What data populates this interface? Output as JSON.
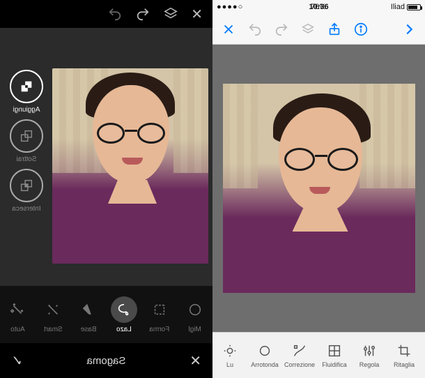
{
  "left": {
    "selection_modes": [
      {
        "label": "Aggiungi",
        "active": true
      },
      {
        "label": "Sottrai",
        "active": false
      },
      {
        "label": "Interseca",
        "active": false
      }
    ],
    "tools": [
      {
        "label": "Migl"
      },
      {
        "label": "Forma"
      },
      {
        "label": "Lazo",
        "active": true
      },
      {
        "label": "Base"
      },
      {
        "label": "Smart"
      },
      {
        "label": "Auto"
      }
    ],
    "footer_title": "Sagoma"
  },
  "right": {
    "status": {
      "signal_pct": "76%",
      "time": "10:36",
      "carrier": "Iliad"
    },
    "tools": [
      {
        "label": "Lu"
      },
      {
        "label": "Arrotonda"
      },
      {
        "label": "Correzione"
      },
      {
        "label": "Fluidifica"
      },
      {
        "label": "Regola"
      },
      {
        "label": "Ritaglia"
      }
    ]
  }
}
